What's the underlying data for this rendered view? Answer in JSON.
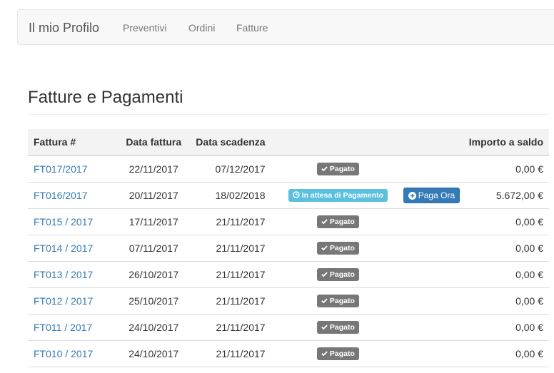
{
  "navbar": {
    "brand": "Il mio Profilo",
    "links": [
      "Preventivi",
      "Ordini",
      "Fatture"
    ]
  },
  "page": {
    "title": "Fatture e Pagamenti"
  },
  "table": {
    "headers": {
      "invoice": "Fattura #",
      "date": "Data fattura",
      "due": "Data scadenza",
      "amount": "Importo a saldo"
    },
    "rows": [
      {
        "invoice": "FT017/2017",
        "date": "22/11/2017",
        "due": "07/12/2017",
        "status": "Pagato",
        "status_type": "paid",
        "action": "",
        "amount": "0,00 €"
      },
      {
        "invoice": "FT016/2017",
        "date": "20/11/2017",
        "due": "18/02/2018",
        "status": "In attesa di Pagamento",
        "status_type": "pending",
        "action": "Paga Ora",
        "amount": "5.672,00 €"
      },
      {
        "invoice": "FT015 / 2017",
        "date": "17/11/2017",
        "due": "21/11/2017",
        "status": "Pagato",
        "status_type": "paid",
        "action": "",
        "amount": "0,00 €"
      },
      {
        "invoice": "FT014 / 2017",
        "date": "07/11/2017",
        "due": "21/11/2017",
        "status": "Pagato",
        "status_type": "paid",
        "action": "",
        "amount": "0,00 €"
      },
      {
        "invoice": "FT013 / 2017",
        "date": "26/10/2017",
        "due": "21/11/2017",
        "status": "Pagato",
        "status_type": "paid",
        "action": "",
        "amount": "0,00 €"
      },
      {
        "invoice": "FT012 / 2017",
        "date": "25/10/2017",
        "due": "21/11/2017",
        "status": "Pagato",
        "status_type": "paid",
        "action": "",
        "amount": "0,00 €"
      },
      {
        "invoice": "FT011 / 2017",
        "date": "24/10/2017",
        "due": "21/11/2017",
        "status": "Pagato",
        "status_type": "paid",
        "action": "",
        "amount": "0,00 €"
      },
      {
        "invoice": "FT010 / 2017",
        "date": "24/10/2017",
        "due": "21/11/2017",
        "status": "Pagato",
        "status_type": "paid",
        "action": "",
        "amount": "0,00 €"
      }
    ]
  },
  "colors": {
    "link": "#337ab7",
    "paid_label": "#777777",
    "pending_label": "#5bc0de",
    "pay_button": "#337ab7"
  },
  "icons": {
    "paid": "check-icon",
    "pending": "clock-icon",
    "pay": "arrow-circle-right-icon"
  }
}
